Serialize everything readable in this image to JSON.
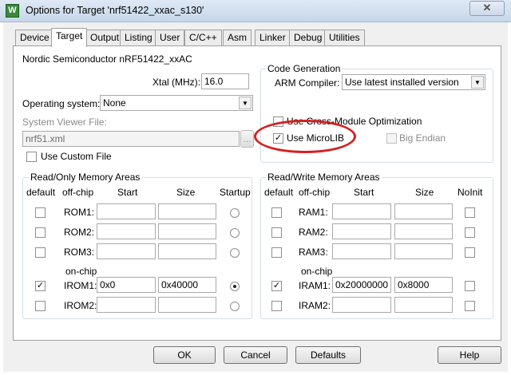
{
  "window": {
    "title": "Options for Target 'nrf51422_xxac_s130'",
    "icon": "keil-uvision-icon",
    "close_glyph": "✕"
  },
  "tabs": [
    {
      "label": "Device",
      "active": false
    },
    {
      "label": "Target",
      "active": true
    },
    {
      "label": "Output",
      "active": false
    },
    {
      "label": "Listing",
      "active": false
    },
    {
      "label": "User",
      "active": false
    },
    {
      "label": "C/C++",
      "active": false
    },
    {
      "label": "Asm",
      "active": false
    },
    {
      "label": "Linker",
      "active": false
    },
    {
      "label": "Debug",
      "active": false
    },
    {
      "label": "Utilities",
      "active": false
    }
  ],
  "target": {
    "device_name": "Nordic Semiconductor nRF51422_xxAC",
    "xtal_label": "Xtal (MHz):",
    "xtal_value": "16.0",
    "os_label": "Operating system:",
    "os_value": "None",
    "svf_label": "System Viewer File:",
    "svf_value": "nrf51.xml",
    "svf_browse": "...",
    "custom_file_label": "Use Custom File",
    "custom_file_checked": false
  },
  "code_generation": {
    "title": "Code Generation",
    "arm_compiler_label": "ARM Compiler:",
    "arm_compiler_value": "Use latest installed version",
    "cross_module_label": "Use Cross-Module Optimization",
    "cross_module_checked": false,
    "microlib_label": "Use MicroLIB",
    "microlib_checked": true,
    "big_endian_label": "Big Endian",
    "big_endian_checked": false,
    "check_glyph": "✓",
    "highlight_color": "#d42020"
  },
  "rom_areas": {
    "title": "Read/Only Memory Areas",
    "headers": {
      "default": "default",
      "offchip": "off-chip",
      "start": "Start",
      "size": "Size",
      "startup": "Startup"
    },
    "onchip_label": "on-chip",
    "rows": [
      {
        "name": "ROM1:",
        "default": false,
        "start": "",
        "size": "",
        "startup": false
      },
      {
        "name": "ROM2:",
        "default": false,
        "start": "",
        "size": "",
        "startup": false
      },
      {
        "name": "ROM3:",
        "default": false,
        "start": "",
        "size": "",
        "startup": false
      },
      {
        "name": "IROM1:",
        "default": true,
        "start": "0x0",
        "size": "0x40000",
        "startup": true
      },
      {
        "name": "IROM2:",
        "default": false,
        "start": "",
        "size": "",
        "startup": false
      }
    ]
  },
  "ram_areas": {
    "title": "Read/Write Memory Areas",
    "headers": {
      "default": "default",
      "offchip": "off-chip",
      "start": "Start",
      "size": "Size",
      "noinit": "NoInit"
    },
    "onchip_label": "on-chip",
    "rows": [
      {
        "name": "RAM1:",
        "default": false,
        "start": "",
        "size": "",
        "noinit": false
      },
      {
        "name": "RAM2:",
        "default": false,
        "start": "",
        "size": "",
        "noinit": false
      },
      {
        "name": "RAM3:",
        "default": false,
        "start": "",
        "size": "",
        "noinit": false
      },
      {
        "name": "IRAM1:",
        "default": true,
        "start": "0x20000000",
        "size": "0x8000",
        "noinit": false
      },
      {
        "name": "IRAM2:",
        "default": false,
        "start": "",
        "size": "",
        "noinit": false
      }
    ]
  },
  "buttons": {
    "ok": "OK",
    "cancel": "Cancel",
    "defaults": "Defaults",
    "help": "Help"
  }
}
